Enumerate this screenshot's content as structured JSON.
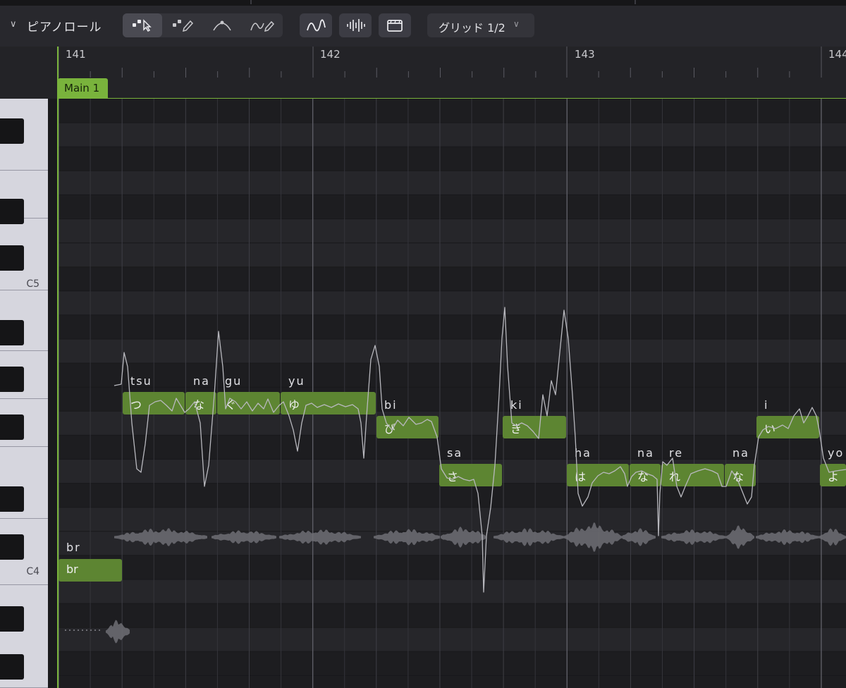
{
  "panel": {
    "title": "ピアノロール"
  },
  "toolbar": {
    "tools": [
      "select-tool",
      "pencil-tool",
      "pitch-curve-tool",
      "freehand-pitch-tool"
    ],
    "toggles": [
      "pitch-curve-toggle",
      "waveform-toggle",
      "video-toggle"
    ],
    "grid_label": "グリッド 1/2"
  },
  "ruler": {
    "bars": [
      "141",
      "142",
      "143",
      "144"
    ]
  },
  "track": {
    "name": "Main 1"
  },
  "keyboard": {
    "labels": [
      "C5",
      "C4"
    ]
  },
  "notes": [
    {
      "lyric": "br",
      "roma": "br"
    },
    {
      "lyric": "つ",
      "roma": "tsu"
    },
    {
      "lyric": "な",
      "roma": "na"
    },
    {
      "lyric": "ぐ",
      "roma": "gu"
    },
    {
      "lyric": "ゆ",
      "roma": "yu"
    },
    {
      "lyric": "び",
      "roma": "bi"
    },
    {
      "lyric": "さ",
      "roma": "sa"
    },
    {
      "lyric": "き",
      "roma": "ki"
    },
    {
      "lyric": "は",
      "roma": "ha"
    },
    {
      "lyric": "な",
      "roma": "na"
    },
    {
      "lyric": "れ",
      "roma": "re"
    },
    {
      "lyric": "な",
      "roma": "na"
    },
    {
      "lyric": "い",
      "roma": "i"
    },
    {
      "lyric": "よ",
      "roma": "yo"
    }
  ],
  "colors": {
    "accent": "#79b33c",
    "note": "#5d8532",
    "background": "#1f1f23",
    "pitch_line": "#b8b8be"
  }
}
